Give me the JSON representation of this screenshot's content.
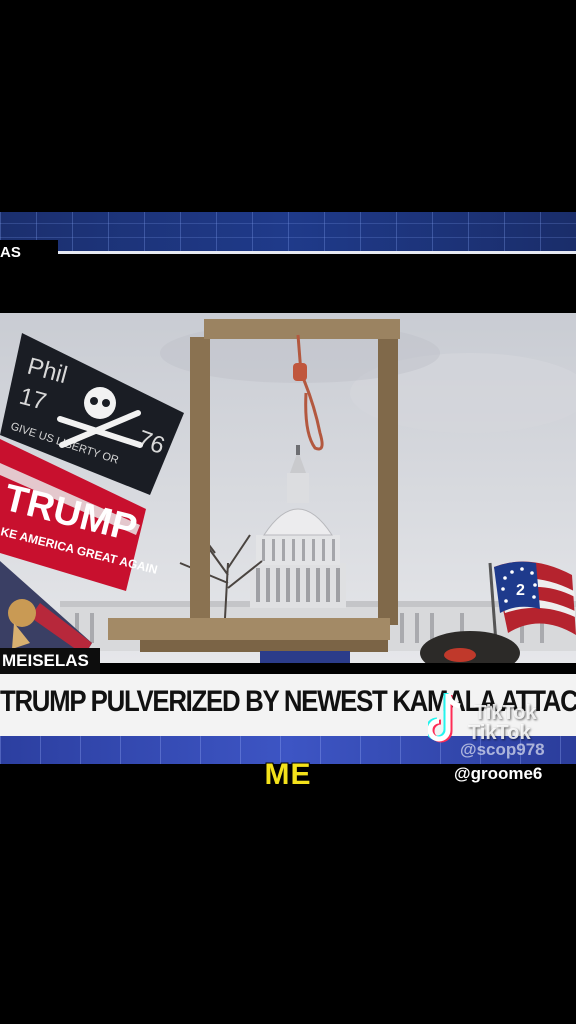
{
  "news": {
    "name_tab": "AS",
    "photo_credit": "MEISELAS",
    "chyron": "TRUMP PULVERIZED BY NEWEST KAMALA ATTACK AD"
  },
  "photo": {
    "flags": {
      "pirate_top": "Phil",
      "pirate_year_left": "17",
      "pirate_year_right": "76",
      "pirate_motto": "GIVE US LIBERTY OR",
      "trump_name": "TRUMP",
      "trump_slogan": "KE AMERICA GREAT AGAIN"
    },
    "betsy_number": "2"
  },
  "caption": {
    "text": "ME"
  },
  "tiktok": {
    "word1": "TikTok",
    "word2": "TikTok",
    "user1": "@scop978",
    "user2": "@groome6"
  },
  "colors": {
    "banner_blue": "#1f3a8a",
    "caption_yellow": "#f4e21b",
    "trump_red": "#c8102e"
  }
}
